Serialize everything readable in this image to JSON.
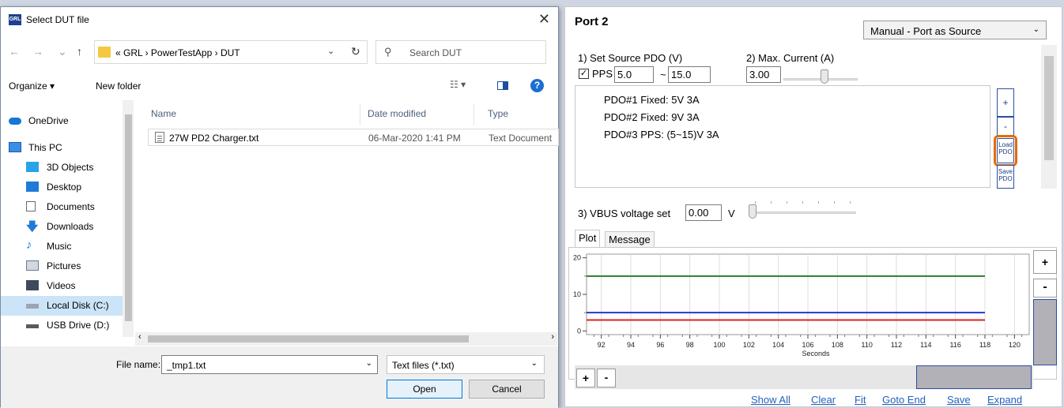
{
  "dialog": {
    "title": "Select DUT file",
    "app_icon_text": "GRL",
    "close_glyph": "✕",
    "nav": {
      "back": "←",
      "forward": "→",
      "up": "↑"
    },
    "breadcrumb": "«  GRL  ›  PowerTestApp  ›  DUT",
    "search_placeholder": "Search DUT",
    "toolbar": {
      "organize": "Organize ▾",
      "new_folder": "New folder",
      "help": "?"
    },
    "nav_items": [
      {
        "label": "OneDrive",
        "icon": "cloud-icon"
      },
      {
        "label": "This PC",
        "icon": "computer-icon"
      },
      {
        "label": "3D Objects",
        "icon": "cube-icon"
      },
      {
        "label": "Desktop",
        "icon": "desktop-icon"
      },
      {
        "label": "Documents",
        "icon": "documents-icon"
      },
      {
        "label": "Downloads",
        "icon": "download-icon"
      },
      {
        "label": "Music",
        "icon": "music-icon"
      },
      {
        "label": "Pictures",
        "icon": "pictures-icon"
      },
      {
        "label": "Videos",
        "icon": "videos-icon"
      },
      {
        "label": "Local Disk (C:)",
        "icon": "disk-icon"
      },
      {
        "label": "USB Drive (D:)",
        "icon": "usb-drive-icon"
      }
    ],
    "columns": {
      "name": "Name",
      "date": "Date modified",
      "type": "Type"
    },
    "files": [
      {
        "name": "27W PD2 Charger.txt",
        "date": "06-Mar-2020 1:41 PM",
        "type": "Text Document"
      }
    ],
    "file_name_label": "File name:",
    "file_name_value": "_tmp1.txt",
    "file_type_value": "Text files (*.txt)",
    "open_label": "Open",
    "cancel_label": "Cancel"
  },
  "panel": {
    "title": "Port 2",
    "mode": "Manual - Port as Source",
    "set_pdo_label": "1) Set Source PDO (V)",
    "max_current_label": "2) Max. Current (A)",
    "pps_label": "PPS",
    "pps_checked": "✓",
    "pps_min": "5.0",
    "tilde": "~",
    "pps_max": "15.0",
    "max_current": "3.00",
    "max_current_slider_level": 0.55,
    "pdo_list": [
      "PDO#1 Fixed: 5V 3A",
      "PDO#2 Fixed: 9V 3A",
      "PDO#3 PPS: (5~15)V 3A"
    ],
    "btn_plus": "+",
    "btn_minus": "-",
    "btn_load": "Load PDO",
    "btn_save": "Save PDO",
    "vbus_label": "3) VBUS voltage set",
    "vbus_value": "0.00",
    "vbus_unit": "V",
    "tabs": [
      "Plot",
      "Message"
    ],
    "zoom_plus": "+",
    "zoom_minus": "-",
    "links": [
      "Show All",
      "Clear",
      "Fit",
      "Goto End",
      "Save",
      "Expand"
    ]
  },
  "chart_data": {
    "type": "line",
    "xlabel": "Seconds",
    "xlim": [
      91,
      121
    ],
    "ylim": [
      -1,
      21
    ],
    "x_ticks": [
      92,
      94,
      96,
      98,
      100,
      102,
      104,
      106,
      108,
      110,
      112,
      114,
      116,
      118,
      120
    ],
    "y_ticks": [
      0,
      10,
      20
    ],
    "grid": true,
    "series": [
      {
        "color": "#2a7f2a",
        "x": [
          91,
          118
        ],
        "y": [
          15,
          15
        ]
      },
      {
        "color": "#2437d0",
        "x": [
          91,
          118
        ],
        "y": [
          5,
          5
        ]
      },
      {
        "color": "#e02020",
        "x": [
          91,
          118
        ],
        "y": [
          3,
          3
        ]
      }
    ]
  }
}
